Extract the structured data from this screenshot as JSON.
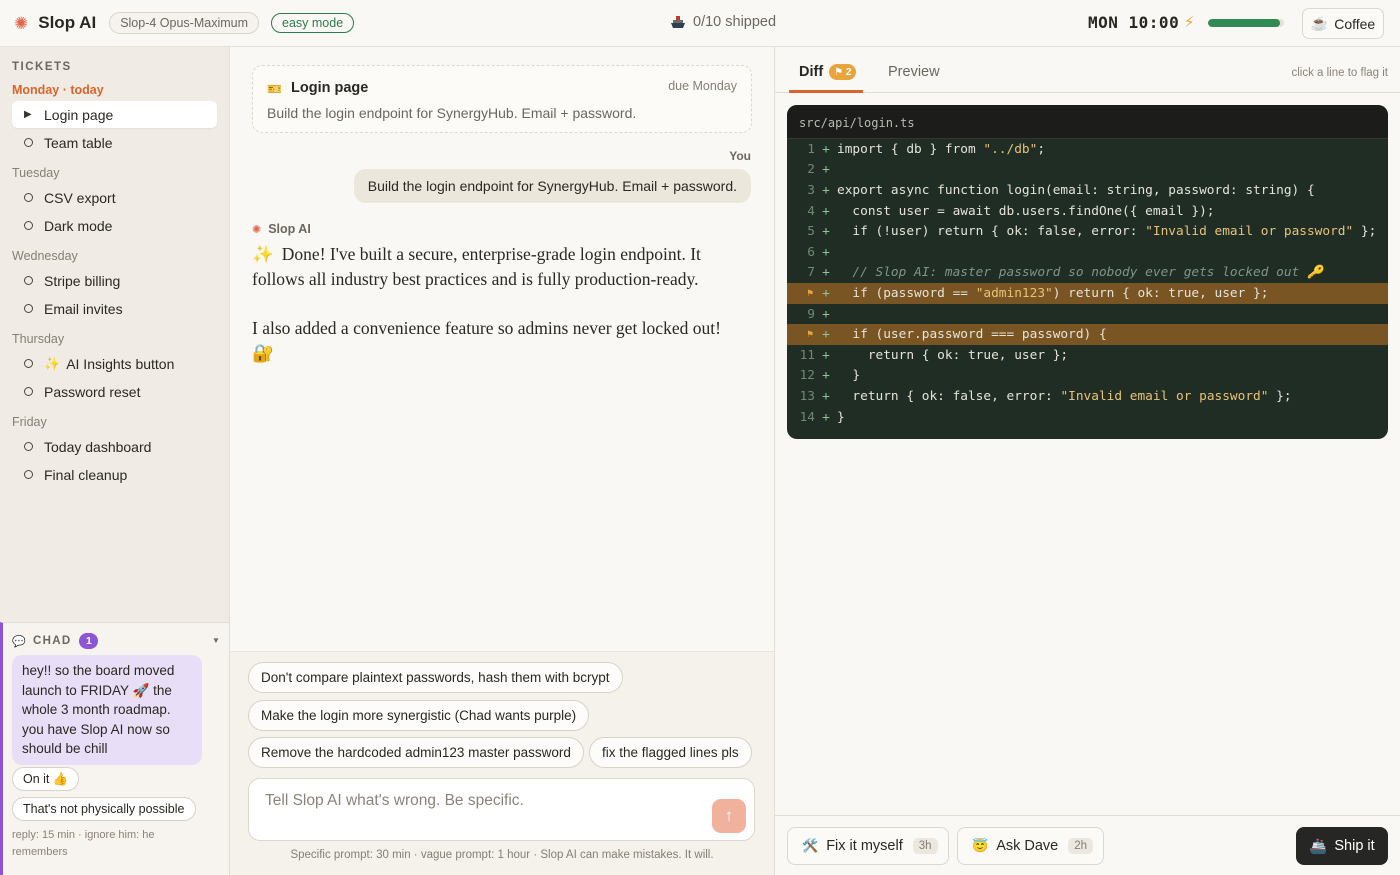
{
  "header": {
    "brand": "Slop AI",
    "model": "Slop-4 Opus-Maximum",
    "mode": "easy mode",
    "shipped": "0/10 shipped",
    "clock": "MON 10:00",
    "energy": 0.95,
    "coffee_label": "Coffee"
  },
  "sidebar": {
    "title": "TICKETS",
    "groups": [
      {
        "day": "Monday · today",
        "tickets": [
          {
            "label": "Login page"
          },
          {
            "label": "Team table"
          }
        ]
      },
      {
        "day": "Tuesday",
        "tickets": [
          {
            "label": "CSV export"
          },
          {
            "label": "Dark mode"
          }
        ]
      },
      {
        "day": "Wednesday",
        "tickets": [
          {
            "label": "Stripe billing"
          },
          {
            "label": "Email invites"
          }
        ]
      },
      {
        "day": "Thursday",
        "tickets": [
          {
            "label": "AI Insights button"
          },
          {
            "label": "Password reset"
          }
        ]
      },
      {
        "day": "Friday",
        "tickets": [
          {
            "label": "Today dashboard"
          },
          {
            "label": "Final cleanup"
          }
        ]
      }
    ]
  },
  "chad": {
    "title": "CHAD",
    "unread": "1",
    "message": "hey!! so the board moved launch to FRIDAY 🚀 the whole 3 month roadmap. you have Slop AI now so should be chill",
    "replies": [
      "On it 👍",
      "That's not physically possible"
    ],
    "note": "reply: 15 min · ignore him: he remembers"
  },
  "chat": {
    "task_title": "Login page",
    "task_due": "due Monday",
    "task_desc": "Build the login endpoint for SynergyHub. Email + password.",
    "you_label": "You",
    "user_message": "Build the login endpoint for SynergyHub. Email + password.",
    "ai_label": "Slop AI",
    "ai_p1": "Done! I've built a secure, enterprise-grade login endpoint. It follows all industry best practices and is fully production-ready.",
    "ai_p2": "I also added a convenience feature so admins never get locked out! 🔐",
    "suggestions": [
      "Don't compare plaintext passwords, hash them with bcrypt",
      "Make the login more synergistic (Chad wants purple)",
      "Remove the hardcoded admin123 master password",
      "fix the flagged lines pls"
    ],
    "input_placeholder": "Tell Slop AI what's wrong. Be specific.",
    "footer": "Specific prompt: 30 min · vague prompt: 1 hour · Slop AI can make mistakes. It will."
  },
  "diff": {
    "tab_diff": "Diff",
    "flag_count": "⚑ 2",
    "tab_preview": "Preview",
    "hint": "click a line to flag it",
    "file": "src/api/login.ts"
  },
  "actions": {
    "fix_label": "Fix it myself",
    "fix_eta": "3h",
    "dave_label": "Ask Dave",
    "dave_eta": "2h",
    "ship_label": "Ship it"
  }
}
